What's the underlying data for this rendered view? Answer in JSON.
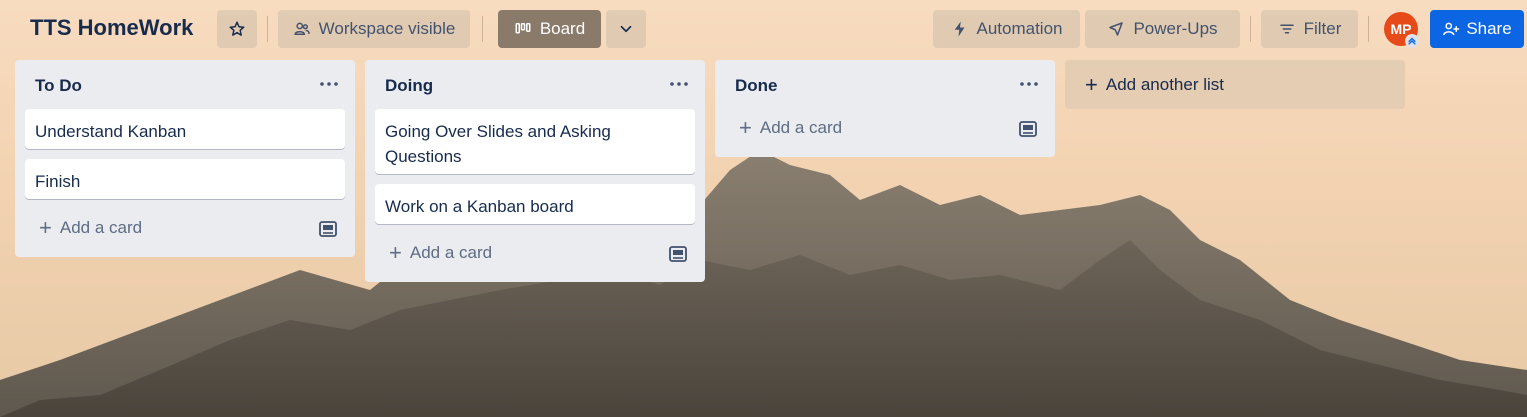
{
  "board": {
    "title": "TTS HomeWork",
    "visibility_label": "Workspace visible",
    "view_label": "Board",
    "automation_label": "Automation",
    "powerups_label": "Power-Ups",
    "filter_label": "Filter",
    "share_label": "Share",
    "avatar_initials": "MP",
    "add_list_label": "Add another list"
  },
  "lists": [
    {
      "title": "To Do",
      "cards": [
        "Understand Kanban",
        "Finish"
      ],
      "add_card_label": "Add a card"
    },
    {
      "title": "Doing",
      "cards": [
        "Going Over Slides and Asking Questions",
        "Work on a Kanban board"
      ],
      "add_card_label": "Add a card"
    },
    {
      "title": "Done",
      "cards": [],
      "add_card_label": "Add a card"
    }
  ],
  "colors": {
    "share_button": "#0c66e4",
    "avatar": "#e64a19",
    "list_background": "#ebecf0"
  }
}
